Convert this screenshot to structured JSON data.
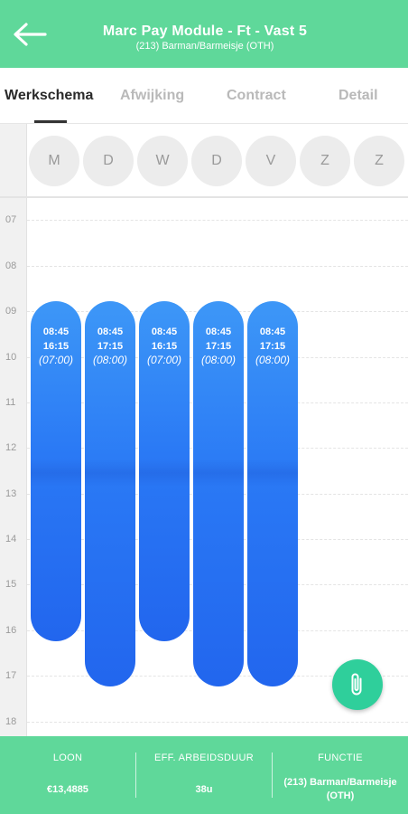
{
  "header": {
    "title": "Marc Pay Module - Ft - Vast 5",
    "subtitle": "(213) Barman/Barmeisje (OTH)",
    "back_icon": "arrow-left-icon",
    "color": "#5fd89a"
  },
  "tabs": [
    {
      "label": "Werkschema",
      "active": true
    },
    {
      "label": "Afwijking",
      "active": false
    },
    {
      "label": "Contract",
      "active": false
    },
    {
      "label": "Detail",
      "active": false
    }
  ],
  "days": [
    "M",
    "D",
    "W",
    "D",
    "V",
    "Z",
    "Z"
  ],
  "hours": [
    "07",
    "08",
    "09",
    "10",
    "11",
    "12",
    "13",
    "14",
    "15",
    "16",
    "17",
    "18"
  ],
  "shifts": [
    {
      "start": "08:45",
      "end": "16:15",
      "duration": "(07:00)"
    },
    {
      "start": "08:45",
      "end": "17:15",
      "duration": "(08:00)"
    },
    {
      "start": "08:45",
      "end": "16:15",
      "duration": "(07:00)"
    },
    {
      "start": "08:45",
      "end": "17:15",
      "duration": "(08:00)"
    },
    {
      "start": "08:45",
      "end": "17:15",
      "duration": "(08:00)"
    }
  ],
  "fab": {
    "icon": "paperclip-icon",
    "color": "#2fcf9b"
  },
  "footer": {
    "loon_label": "LOON",
    "loon_value": "€13,4885",
    "arbeidsduur_label": "EFF. ARBEIDSDUUR",
    "arbeidsduur_value": "38u",
    "functie_label": "FUNCTIE",
    "functie_value": "(213) Barman/Barmeisje (OTH)"
  },
  "colors": {
    "shift": "#2a79f5",
    "accent": "#5fd89a"
  }
}
